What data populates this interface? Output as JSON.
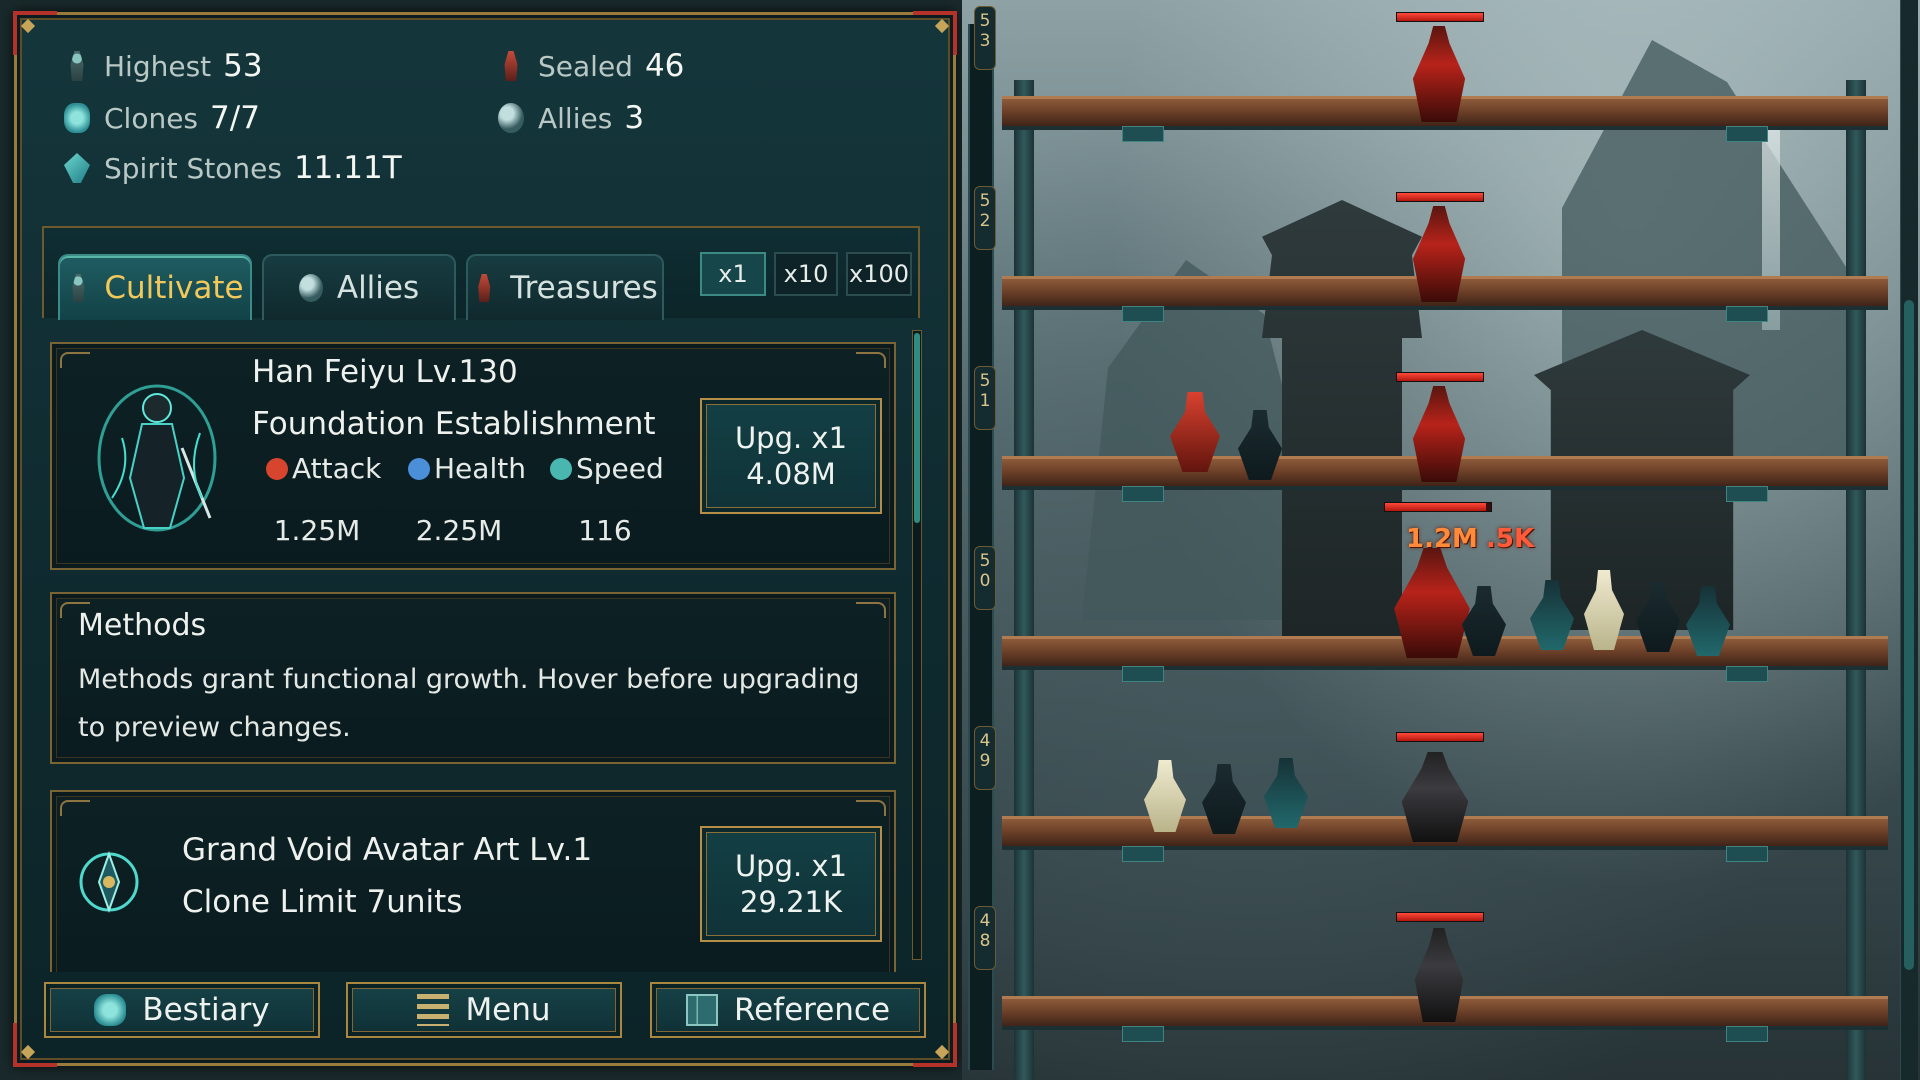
{
  "stats": {
    "highest": {
      "label": "Highest",
      "value": "53"
    },
    "sealed": {
      "label": "Sealed",
      "value": "46"
    },
    "clones": {
      "label": "Clones",
      "value": "7/7"
    },
    "allies": {
      "label": "Allies",
      "value": "3"
    },
    "spirit_stones": {
      "label": "Spirit Stones",
      "value": "11.11T"
    }
  },
  "tabs": [
    {
      "label": "Cultivate",
      "active": true
    },
    {
      "label": "Allies",
      "active": false
    },
    {
      "label": "Treasures",
      "active": false
    }
  ],
  "multipliers": [
    {
      "label": "x1",
      "active": true
    },
    {
      "label": "x10",
      "active": false
    },
    {
      "label": "x100",
      "active": false
    }
  ],
  "hero": {
    "name": "Han Feiyu Lv.130",
    "realm": "Foundation Establishment",
    "attributes": [
      {
        "label": "Attack",
        "value": "1.25M",
        "icon": "attack-icon",
        "color": "#d8452f"
      },
      {
        "label": "Health",
        "value": "2.25M",
        "icon": "health-icon",
        "color": "#4a8fd8"
      },
      {
        "label": "Speed",
        "value": "116",
        "icon": "speed-icon",
        "color": "#49b7b0"
      }
    ],
    "upgrade": {
      "line1": "Upg. x1",
      "line2": "4.08M"
    }
  },
  "methods": {
    "title": "Methods",
    "description": "Methods grant functional growth. Hover before upgrading to preview changes."
  },
  "art": {
    "name": "Grand Void Avatar Art Lv.1",
    "desc": "Clone Limit 7units",
    "upgrade": {
      "line1": "Upg. x1",
      "line2": "29.21K"
    }
  },
  "bottom_buttons": [
    {
      "label": "Bestiary",
      "icon": "bestiary-icon"
    },
    {
      "label": "Menu",
      "icon": "menu-icon"
    },
    {
      "label": "Reference",
      "icon": "reference-icon"
    }
  ],
  "floors": [
    "53",
    "52",
    "51",
    "50",
    "49",
    "48"
  ],
  "damage_numbers": [
    "1.2M",
    ".5K"
  ],
  "colors": {
    "accent_gold": "#f2c85a",
    "panel_teal": "#14363b",
    "border_gold": "#9a7b3e",
    "corner_red": "#b5322a",
    "hp_red": "#ff4a3a"
  }
}
